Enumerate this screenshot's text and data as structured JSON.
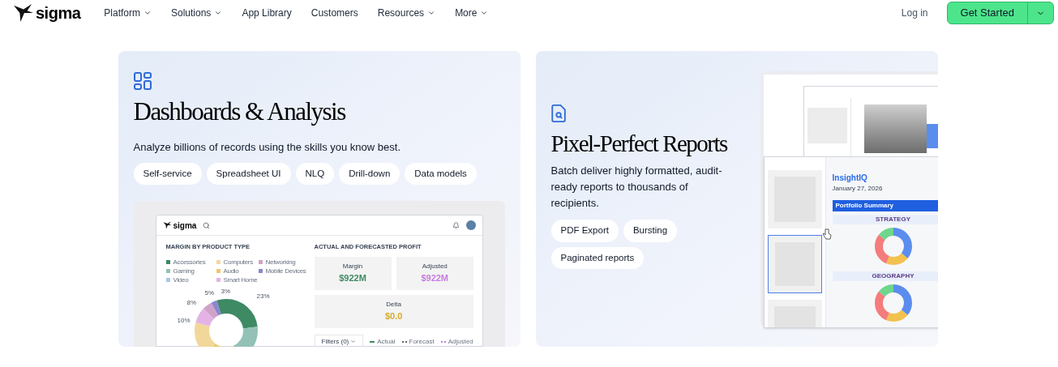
{
  "nav": {
    "brand": "sigma",
    "links": [
      {
        "label": "Platform",
        "dropdown": true
      },
      {
        "label": "Solutions",
        "dropdown": true
      },
      {
        "label": "App Library",
        "dropdown": false
      },
      {
        "label": "Customers",
        "dropdown": false
      },
      {
        "label": "Resources",
        "dropdown": true
      },
      {
        "label": "More",
        "dropdown": true
      }
    ],
    "login": "Log in",
    "cta": "Get Started"
  },
  "cards": [
    {
      "kind": "dashboard",
      "title": "Dashboards & Analysis",
      "description": "Analyze billions of records using the skills you know best.",
      "tags": [
        "Self-service",
        "Spreadsheet UI",
        "NLQ",
        "Drill-down",
        "Data models"
      ],
      "preview": {
        "brand": "sigma",
        "left_title": "MARGIN BY PRODUCT TYPE",
        "legend": [
          {
            "label": "Accessories",
            "color": "#3e8a64"
          },
          {
            "label": "Computers",
            "color": "#f2d79b"
          },
          {
            "label": "Networking",
            "color": "#cfa3c9"
          },
          {
            "label": "Gaming",
            "color": "#93c1b6"
          },
          {
            "label": "Audio",
            "color": "#ecc96a"
          },
          {
            "label": "Mobile Devices",
            "color": "#8b87cf"
          },
          {
            "label": "Video",
            "color": "#a9c6e8"
          },
          {
            "label": "Smart Home",
            "color": "#e3b3e6"
          }
        ],
        "donut_labels": [
          "23%",
          "10%",
          "8%",
          "5%",
          "3%"
        ],
        "right_title": "ACTUAL AND FORECASTED PROFIT",
        "metrics": [
          {
            "label": "Margin",
            "value": "$922M",
            "color": "#3e8a64"
          },
          {
            "label": "Adjusted",
            "value": "$922M",
            "color": "#c77de0"
          },
          {
            "label": "Delta",
            "value": "$0.0",
            "color": "#d9ac2e"
          }
        ],
        "filter": "Filters (0)",
        "series": [
          {
            "label": "Actual",
            "color": "#3e8a64"
          },
          {
            "label": "Forecast",
            "color": "#666666"
          },
          {
            "label": "Adjusted",
            "color": "#c77de0"
          }
        ]
      }
    },
    {
      "kind": "report",
      "title": "Pixel-Perfect Reports",
      "description": "Batch deliver highly formatted, audit-ready reports to thousands of recipients.",
      "tags": [
        "PDF Export",
        "Bursting",
        "Paginated reports"
      ],
      "preview": {
        "brand": "InsightIQ",
        "date": "January 27, 2026",
        "banner": "Portfolio Summary",
        "sections": [
          {
            "title": "STRATEGY"
          },
          {
            "title": "GEOGRAPHY"
          }
        ]
      }
    }
  ]
}
